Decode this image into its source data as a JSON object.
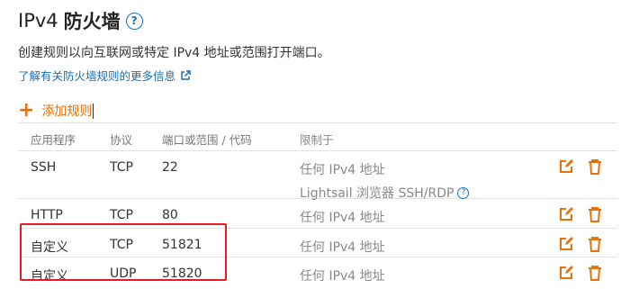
{
  "header": {
    "title_pre": "IPv4",
    "title_main": "防火墙",
    "help_glyph": "?"
  },
  "description": "创建规则以向互联网或特定 IPv4 地址或范围打开端口。",
  "learn_more_link": "了解有关防火墙规则的更多信息",
  "add_rule_label": "添加规则",
  "table": {
    "columns": [
      "应用程序",
      "协议",
      "端口或范围 / 代码",
      "限制于"
    ],
    "rows": [
      {
        "app": "SSH",
        "protocol": "TCP",
        "port": "22",
        "restrict": "任何 IPv4 地址",
        "restrict_extra": "Lightsail 浏览器 SSH/RDP"
      },
      {
        "app": "HTTP",
        "protocol": "TCP",
        "port": "80",
        "restrict": "任何 IPv4 地址"
      },
      {
        "app": "自定义",
        "protocol": "TCP",
        "port": "51821",
        "restrict": "任何 IPv4 地址"
      },
      {
        "app": "自定义",
        "protocol": "UDP",
        "port": "51820",
        "restrict": "任何 IPv4 地址"
      }
    ]
  },
  "colors": {
    "accent_orange": "#e8710a",
    "link_blue": "#1a6fb5",
    "highlight_red": "#e51c23"
  }
}
